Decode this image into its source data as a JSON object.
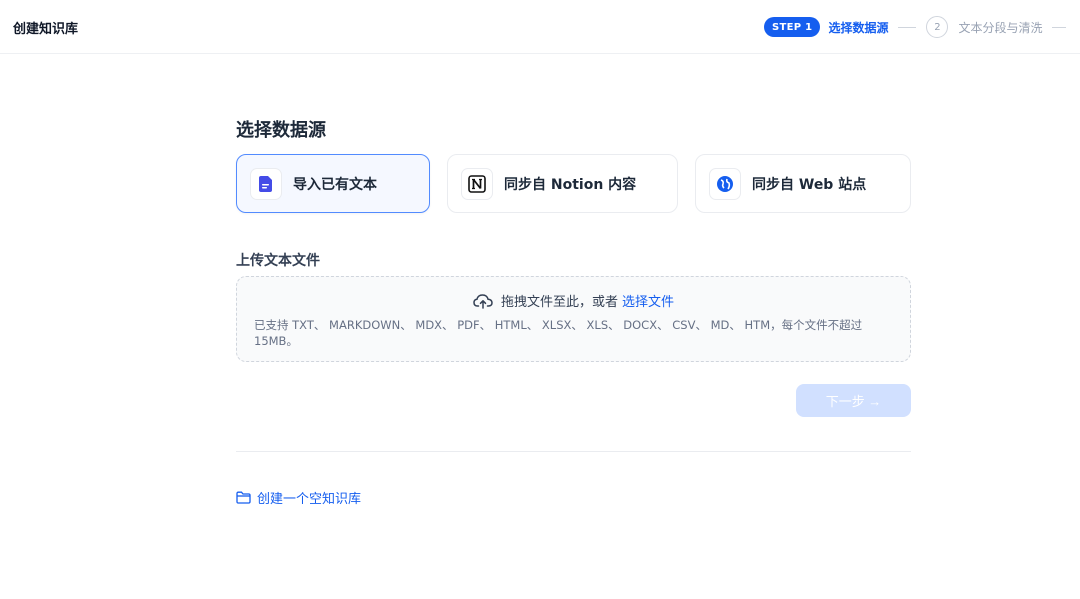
{
  "header": {
    "title": "创建知识库",
    "steps": [
      {
        "badge": "STEP 1",
        "label": "选择数据源",
        "active": true
      },
      {
        "badge": "2",
        "label": "文本分段与清洗",
        "active": false
      }
    ]
  },
  "main": {
    "section_title": "选择数据源",
    "sources": [
      {
        "label": "导入已有文本",
        "icon": "document-icon",
        "active": true
      },
      {
        "label": "同步自 Notion 内容",
        "icon": "notion-icon",
        "active": false
      },
      {
        "label": "同步自 Web 站点",
        "icon": "globe-icon",
        "active": false
      }
    ],
    "upload": {
      "title": "上传文本文件",
      "drag_text": "拖拽文件至此，或者",
      "select_link": "选择文件",
      "hint": "已支持 TXT、 MARKDOWN、 MDX、 PDF、 HTML、 XLSX、 XLS、 DOCX、 CSV、 MD、 HTM，每个文件不超过 15MB。"
    },
    "next_button": "下一步 →",
    "empty_kb_link": "创建一个空知识库"
  },
  "colors": {
    "accent": "#155eef",
    "active_border": "#528bff",
    "disabled_button": "#d1e0ff"
  }
}
